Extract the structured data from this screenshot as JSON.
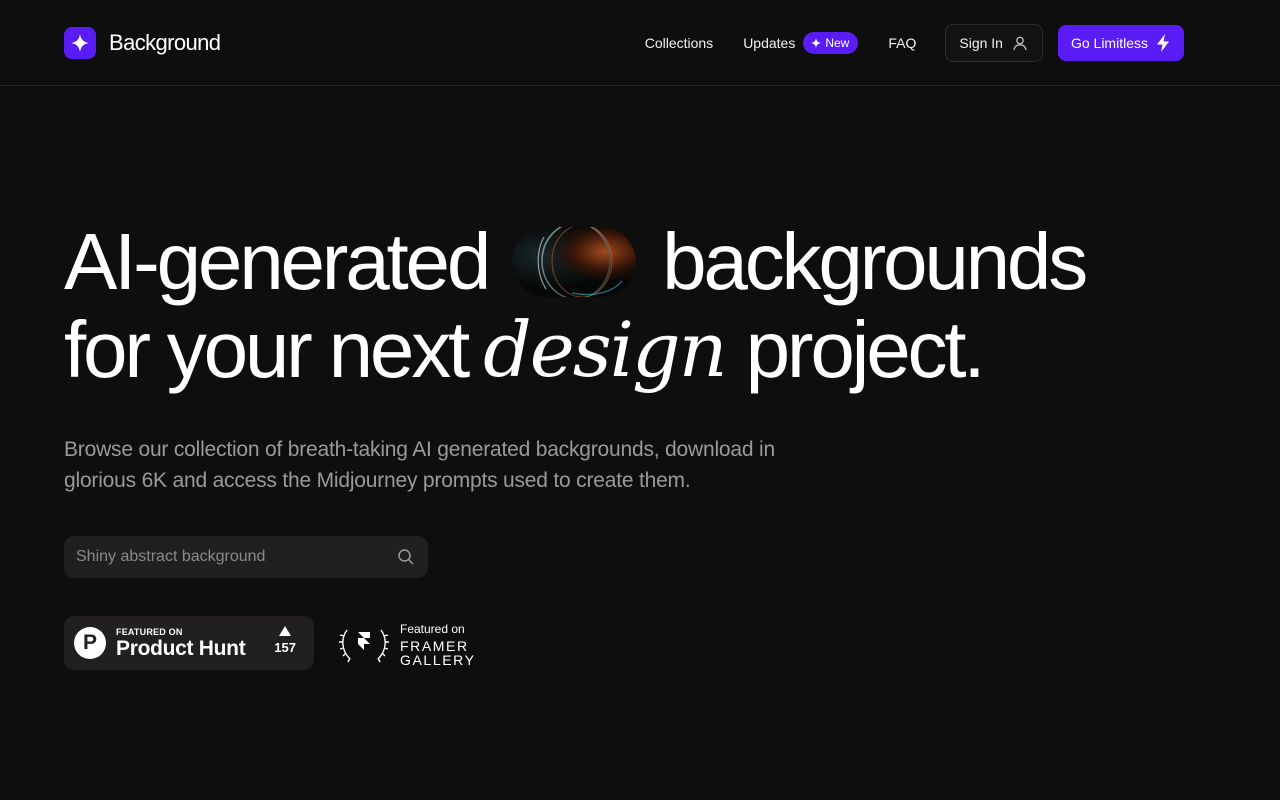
{
  "brand": {
    "name": "Background",
    "accent": "#5a1cf5"
  },
  "nav": {
    "collections": "Collections",
    "updates": "Updates",
    "new_badge": "New",
    "faq": "FAQ",
    "sign_in": "Sign In",
    "go_limitless": "Go Limitless"
  },
  "hero": {
    "line1_a": "AI-generated",
    "line1_b": "backgrounds",
    "line2_a": "for your next",
    "line2_italic": "design",
    "line2_b": "project.",
    "subtitle": "Browse our collection of breath-taking AI generated backgrounds, download in glorious 6K and access the Midjourney prompts used to create them."
  },
  "search": {
    "placeholder": "Shiny abstract background",
    "value": ""
  },
  "product_hunt": {
    "kicker": "FEATURED ON",
    "name": "Product Hunt",
    "logo_letter": "P",
    "votes": "157"
  },
  "framer": {
    "kicker": "Featured on",
    "name": "Framer Gallery"
  },
  "icons": {
    "brand": "sparkle-icon",
    "new": "sparkle-icon",
    "sign_in": "user-icon",
    "limitless": "lightning-icon",
    "search": "search-icon",
    "framer": "laurel-framer-icon"
  }
}
